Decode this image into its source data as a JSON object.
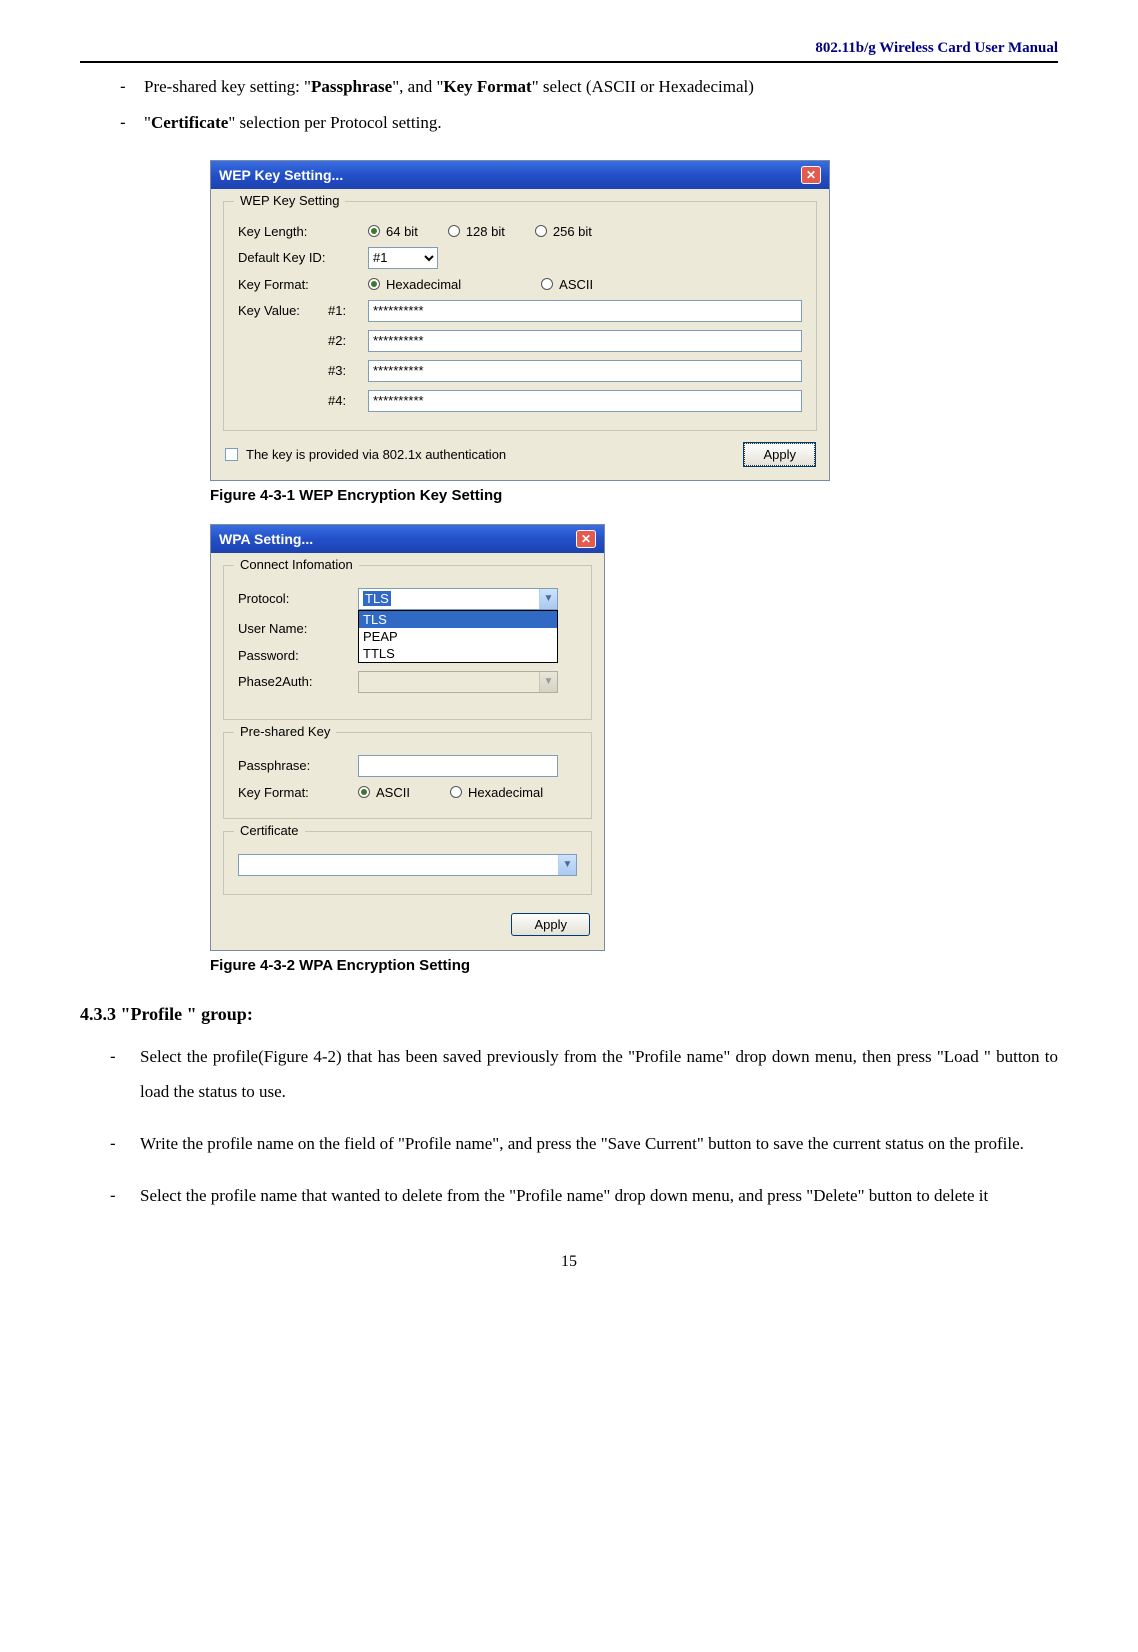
{
  "header": {
    "title": "802.11b/g Wireless Card User Manual"
  },
  "intro_bullets": [
    {
      "prefix": "Pre-shared key setting: \"",
      "bold1": "Passphrase",
      "mid": "\", and \"",
      "bold2": "Key Format",
      "suffix": "\" select (ASCII or Hexadecimal)"
    },
    {
      "prefix": "\"",
      "bold1": "Certificate",
      "mid": "\" selection per Protocol setting.",
      "bold2": "",
      "suffix": ""
    }
  ],
  "wep_dialog": {
    "title": "WEP Key Setting...",
    "group_legend": "WEP Key Setting",
    "key_length_label": "Key Length:",
    "len_opts": [
      "64 bit",
      "128 bit",
      "256 bit"
    ],
    "default_key_label": "Default Key ID:",
    "default_key_value": "#1",
    "key_format_label": "Key Format:",
    "fmt_opts": [
      "Hexadecimal",
      "ASCII"
    ],
    "key_value_label": "Key Value:",
    "rows": [
      {
        "idx": "#1:",
        "val": "**********"
      },
      {
        "idx": "#2:",
        "val": "**********"
      },
      {
        "idx": "#3:",
        "val": "**********"
      },
      {
        "idx": "#4:",
        "val": "**********"
      }
    ],
    "cb_label": "The key is provided via 802.1x authentication",
    "apply": "Apply"
  },
  "fig1_caption": "Figure 4-3-1 WEP Encryption Key Setting",
  "wpa_dialog": {
    "title": "WPA Setting...",
    "grp_conn": "Connect Infomation",
    "protocol_label": "Protocol:",
    "protocol_sel": "TLS",
    "protocol_opts": [
      "TLS",
      "PEAP",
      "TTLS"
    ],
    "user_label": "User Name:",
    "pass_label": "Password:",
    "phase_label": "Phase2Auth:",
    "grp_psk": "Pre-shared Key",
    "passphrase_label": "Passphrase:",
    "keyformat_label": "Key Format:",
    "fmt_opts": [
      "ASCII",
      "Hexadecimal"
    ],
    "grp_cert": "Certificate",
    "apply": "Apply"
  },
  "fig2_caption": "Figure 4-3-2 WPA Encryption Setting",
  "section_heading": "4.3.3 \"Profile \" group:",
  "para_items": [
    "Select the profile(Figure 4-2) that has been saved previously from the \"Profile name\" drop down menu, then press \"Load \" button to load the status to use.",
    "Write the profile name on the field of \"Profile name\", and press the \"Save Current\" button to save the current status on the profile.",
    "Select the profile name that wanted to delete from the \"Profile name\" drop down menu, and press \"Delete\" button to delete it"
  ],
  "page_number": "15"
}
